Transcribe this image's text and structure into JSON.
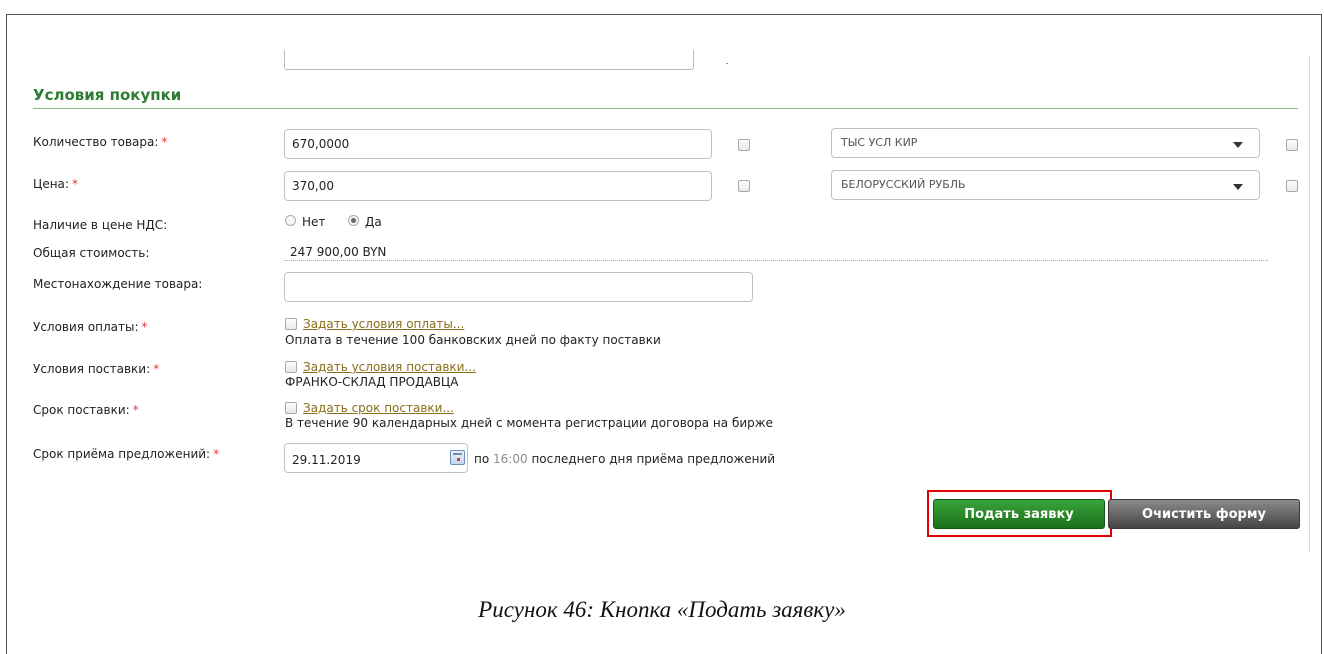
{
  "section": {
    "title": "Условия покупки"
  },
  "quantity": {
    "label": "Количество товара:",
    "required": "*",
    "value": "670,0000",
    "unit": "ТЫС УСЛ КИР"
  },
  "price": {
    "label": "Цена:",
    "required": "*",
    "value": "370,00",
    "currency": "БЕЛОРУССКИЙ РУБЛЬ"
  },
  "vat": {
    "label": "Наличие в цене НДС:",
    "option_no": "Нет",
    "option_yes": "Да",
    "selected": "Да"
  },
  "total": {
    "label": "Общая стоимость:",
    "value": "247 900,00 BYN"
  },
  "location": {
    "label": "Местонахождение товара:",
    "value": ""
  },
  "payment": {
    "label": "Условия оплаты:",
    "required": "*",
    "link": "Задать условия оплаты...",
    "value": "Оплата в течение 100 банковских дней по факту поставки"
  },
  "delivery": {
    "label": "Условия поставки:",
    "required": "*",
    "link": "Задать условия поставки...",
    "value": "ФРАНКО-СКЛАД ПРОДАВЦА"
  },
  "term": {
    "label": "Срок поставки:",
    "required": "*",
    "link": "Задать срок поставки...",
    "value": "В течение 90 календарных дней с момента регистрации договора на бирже"
  },
  "deadline": {
    "label": "Срок приёма предложений:",
    "required": "*",
    "date": "29.11.2019",
    "prefix": "по",
    "time": "16:00",
    "suffix": "последнего дня приёма предложений"
  },
  "buttons": {
    "submit": "Подать заявку",
    "clear": "Очистить форму"
  },
  "caption": "Рисунок 46: Кнопка «Подать заявку»",
  "colors": {
    "accent": "#2e7d32",
    "required": "#e53935",
    "link": "#8a6d1a",
    "highlight": "#e00000"
  }
}
